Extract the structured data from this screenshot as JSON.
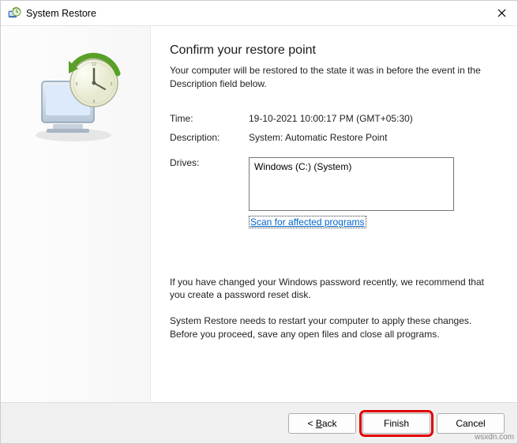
{
  "titlebar": {
    "title": "System Restore"
  },
  "main": {
    "heading": "Confirm your restore point",
    "subtext": "Your computer will be restored to the state it was in before the event in the Description field below.",
    "time_label": "Time:",
    "time_value": "19-10-2021 10:00:17 PM (GMT+05:30)",
    "description_label": "Description:",
    "description_value": "System: Automatic Restore Point",
    "drives_label": "Drives:",
    "drives_value": "Windows (C:) (System)",
    "scan_link": "Scan for affected programs",
    "note1": "If you have changed your Windows password recently, we recommend that you create a password reset disk.",
    "note2": "System Restore needs to restart your computer to apply these changes. Before you proceed, save any open files and close all programs."
  },
  "buttons": {
    "back_prefix": "< ",
    "back_u": "B",
    "back_rest": "ack",
    "finish": "Finish",
    "cancel": "Cancel"
  },
  "watermark": "wsxdn.com"
}
